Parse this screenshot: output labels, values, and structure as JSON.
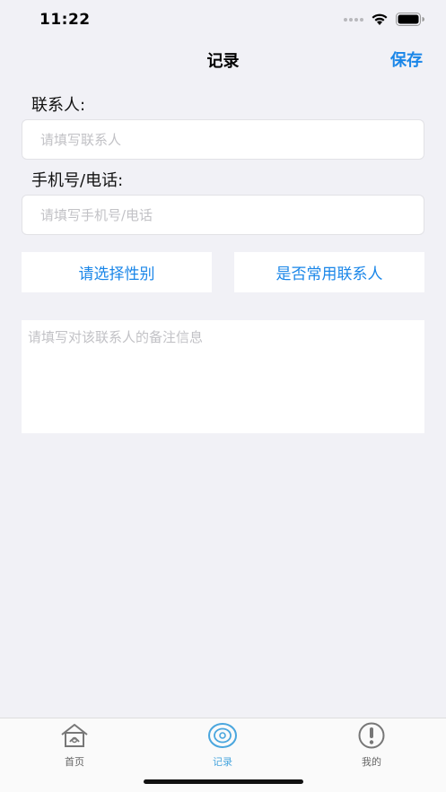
{
  "status_bar": {
    "time": "11:22"
  },
  "nav": {
    "title": "记录",
    "save_label": "保存"
  },
  "form": {
    "contact_label": "联系人:",
    "contact_placeholder": "请填写联系人",
    "contact_value": "",
    "phone_label": "手机号/电话:",
    "phone_placeholder": "请填写手机号/电话",
    "phone_value": "",
    "gender_button": "请选择性别",
    "frequent_button": "是否常用联系人",
    "notes_placeholder": "请填写对该联系人的备注信息",
    "notes_value": ""
  },
  "tab_bar": {
    "tabs": [
      {
        "label": "首页",
        "icon": "home-icon",
        "active": false
      },
      {
        "label": "记录",
        "icon": "record-icon",
        "active": true
      },
      {
        "label": "我的",
        "icon": "profile-icon",
        "active": false
      }
    ]
  },
  "colors": {
    "accent": "#1a86e8",
    "background": "#f1f1f6",
    "active_tab": "#4aa6de",
    "inactive_tab": "#666666"
  }
}
